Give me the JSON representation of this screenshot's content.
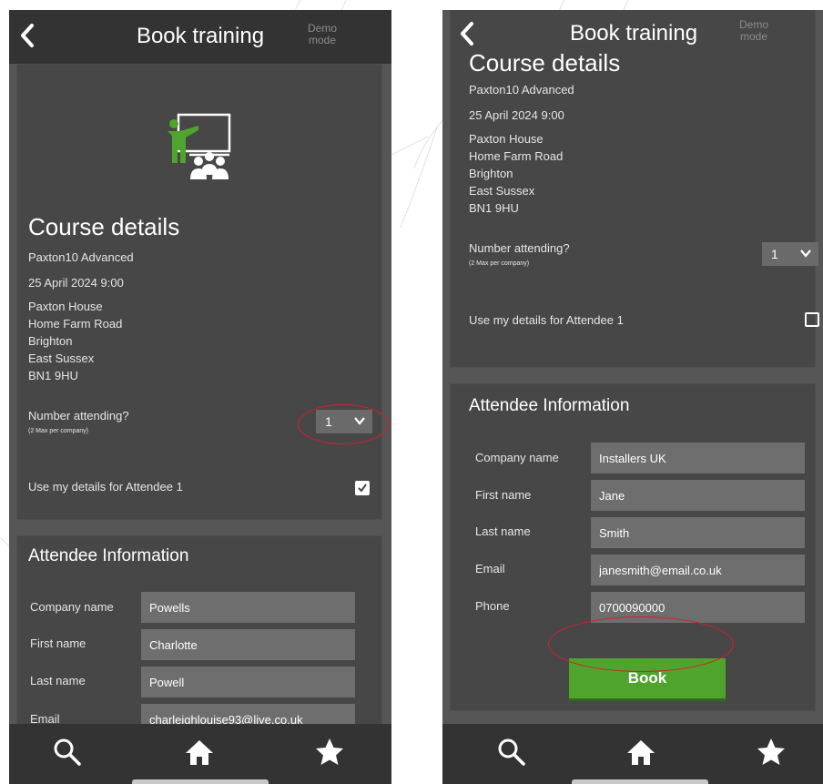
{
  "left": {
    "header": {
      "title": "Book training",
      "demo_mode": "Demo\nmode"
    },
    "course": {
      "title": "Course details",
      "name": "Paxton10 Advanced",
      "datetime": "25 April 2024  9:00",
      "address": [
        "Paxton House",
        "Home Farm Road",
        "Brighton",
        "East Sussex",
        "BN1 9HU"
      ]
    },
    "attending": {
      "label": "Number attending?",
      "sublabel": "(2 Max per company)",
      "value": "1"
    },
    "use_details": {
      "label": "Use my details for Attendee 1",
      "checked": true
    },
    "attendee": {
      "title": "Attendee Information",
      "fields": [
        {
          "label": "Company name",
          "value": "Powells"
        },
        {
          "label": "First name",
          "value": "Charlotte"
        },
        {
          "label": "Last name",
          "value": "Powell"
        },
        {
          "label": "Email",
          "value": "charleighlouise93@live.co.uk"
        }
      ]
    }
  },
  "right": {
    "header": {
      "title": "Book training",
      "demo_mode": "Demo\nmode"
    },
    "course": {
      "title": "Course details",
      "name": "Paxton10 Advanced",
      "datetime": "25 April 2024  9:00",
      "address": [
        "Paxton House",
        "Home Farm Road",
        "Brighton",
        "East Sussex",
        "BN1 9HU"
      ]
    },
    "attending": {
      "label": "Number attending?",
      "sublabel": "(2 Max per company)",
      "value": "1"
    },
    "use_details": {
      "label": "Use my details for Attendee 1",
      "checked": false
    },
    "attendee": {
      "title": "Attendee Information",
      "fields": [
        {
          "label": "Company name",
          "value": "Installers UK"
        },
        {
          "label": "First name",
          "value": "Jane"
        },
        {
          "label": "Last name",
          "value": "Smith"
        },
        {
          "label": "Email",
          "value": "janesmith@email.co.uk"
        },
        {
          "label": "Phone",
          "value": "0700090000"
        }
      ]
    },
    "book_button": "Book"
  },
  "nav": {
    "icons": [
      "search-icon",
      "home-icon",
      "star-icon"
    ]
  },
  "colors": {
    "accent_green": "#4fa42e",
    "annotation_red": "#d41f2a",
    "background": "#333333",
    "card": "#474747"
  }
}
